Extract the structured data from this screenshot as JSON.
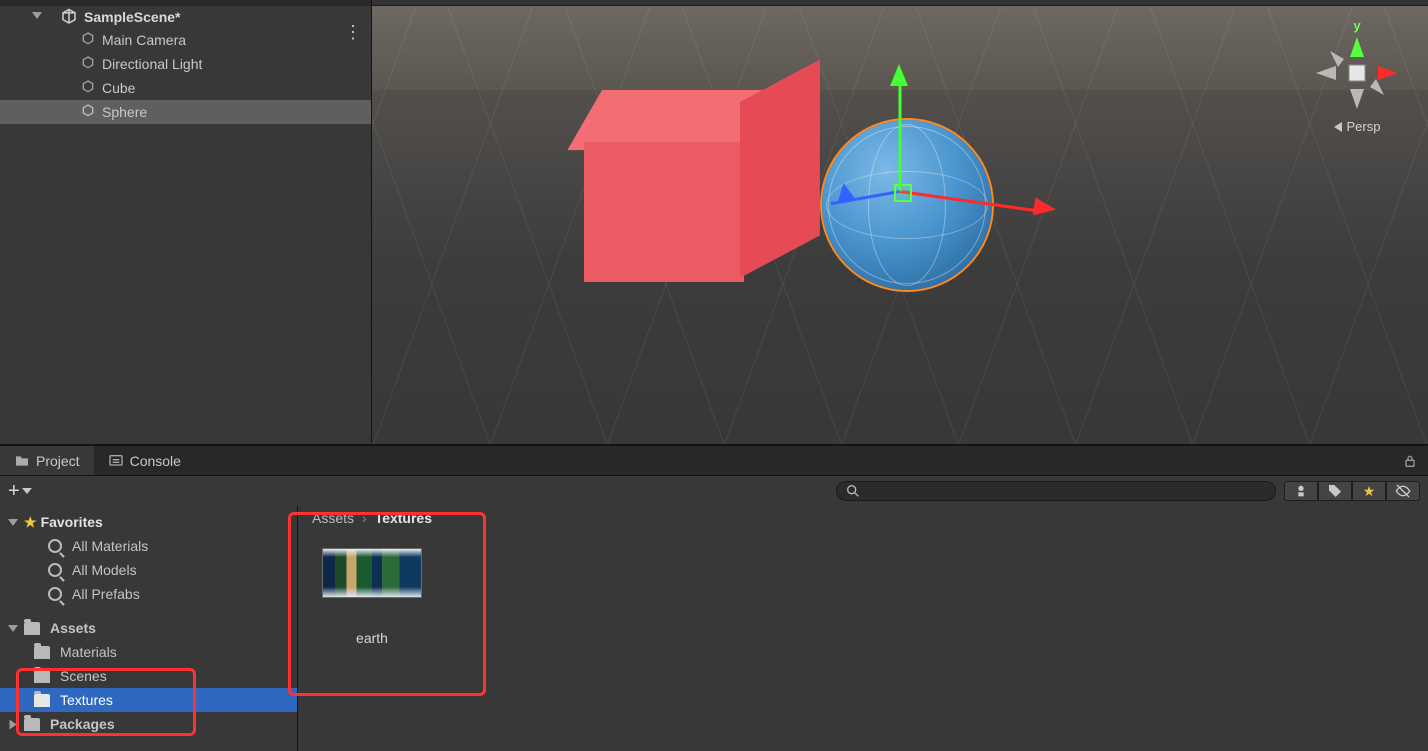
{
  "hierarchy": {
    "scene_name": "SampleScene*",
    "items": [
      {
        "label": "Main Camera"
      },
      {
        "label": "Directional Light"
      },
      {
        "label": "Cube"
      },
      {
        "label": "Sphere"
      }
    ]
  },
  "scene_view": {
    "gizmo_y_label": "y",
    "projection_label": "Persp",
    "objects": [
      "Cube",
      "Sphere"
    ],
    "selected": "Sphere"
  },
  "project_panel": {
    "tabs": {
      "project": "Project",
      "console": "Console"
    },
    "search_placeholder": "",
    "favorites": {
      "label": "Favorites",
      "items": [
        "All Materials",
        "All Models",
        "All Prefabs"
      ]
    },
    "assets": {
      "label": "Assets",
      "folders": [
        "Materials",
        "Scenes",
        "Textures"
      ]
    },
    "packages_label": "Packages",
    "breadcrumbs": {
      "root": "Assets",
      "current": "Textures"
    },
    "grid_items": [
      {
        "name": "earth"
      }
    ]
  },
  "icons": {
    "favorite": "★",
    "search": "⌕"
  }
}
